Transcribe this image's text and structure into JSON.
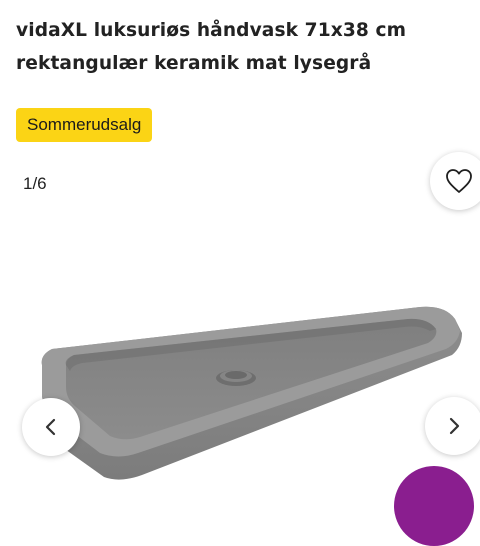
{
  "product": {
    "title_line1": "vidaXL luksuriøs håndvask 71x38 cm",
    "title_line2": "rektangulær keramik mat lysegrå",
    "badge": "Sommerudsalg"
  },
  "gallery": {
    "counter": "1/6",
    "image": "grey-rectangular-sink"
  },
  "icons": {
    "favorite": "heart-icon",
    "previous": "chevron-left-icon",
    "next": "chevron-right-icon"
  },
  "colors": {
    "badge_bg": "#fbd415",
    "sink_grey": "#8f8f8f",
    "accent_purple": "#8a1e8f"
  }
}
